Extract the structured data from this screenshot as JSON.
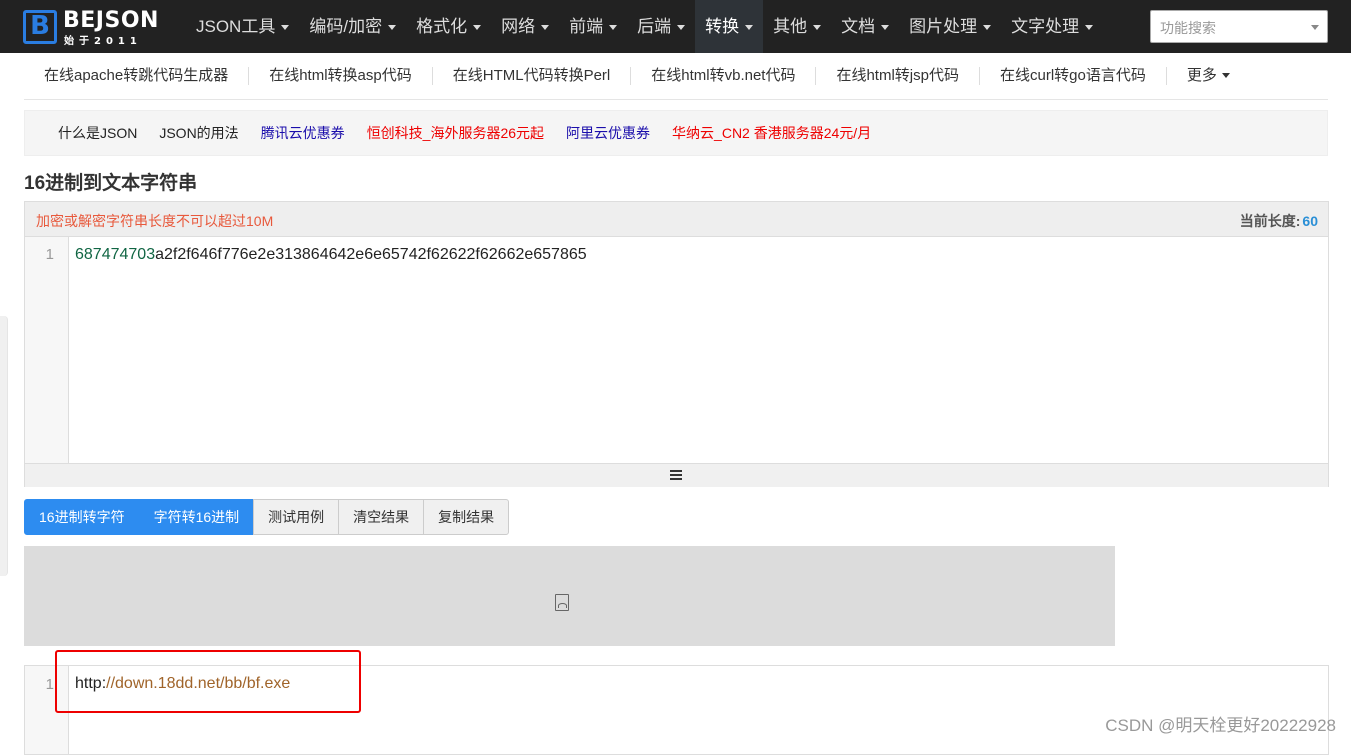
{
  "logo": {
    "brand": "BEJSON",
    "mark": "B",
    "tagline": "始于2011"
  },
  "nav": {
    "items": [
      {
        "label": "JSON工具",
        "active": false
      },
      {
        "label": "编码/加密",
        "active": false
      },
      {
        "label": "格式化",
        "active": false
      },
      {
        "label": "网络",
        "active": false
      },
      {
        "label": "前端",
        "active": false
      },
      {
        "label": "后端",
        "active": false
      },
      {
        "label": "转换",
        "active": true
      },
      {
        "label": "其他",
        "active": false
      },
      {
        "label": "文档",
        "active": false
      },
      {
        "label": "图片处理",
        "active": false
      },
      {
        "label": "文字处理",
        "active": false
      }
    ],
    "search_placeholder": "功能搜索"
  },
  "subtools": [
    "在线apache转跳代码生成器",
    "在线html转换asp代码",
    "在线HTML代码转换Perl",
    "在线html转vb.net代码",
    "在线html转jsp代码",
    "在线curl转go语言代码",
    "更多"
  ],
  "links": [
    {
      "label": "什么是JSON",
      "color": "dark"
    },
    {
      "label": "JSON的用法",
      "color": "dark"
    },
    {
      "label": "腾讯云优惠券",
      "color": "blue"
    },
    {
      "label": "恒创科技_海外服务器26元起",
      "color": "red"
    },
    {
      "label": "阿里云优惠券",
      "color": "blue"
    },
    {
      "label": "华纳云_CN2 香港服务器24元/月",
      "color": "red"
    }
  ],
  "page_title": "16进制到文本字符串",
  "editor": {
    "warning": "加密或解密字符串长度不可以超过10M",
    "length_label": "当前长度:",
    "length_value": "60",
    "line_number": "1",
    "code_number_part": "687474703",
    "code_rest": "a2f2f646f776e2e313864642e6e65742f62622f62662e657865"
  },
  "buttons": [
    {
      "label": "16进制转字符",
      "primary": true
    },
    {
      "label": "字符转16进制",
      "primary": true
    },
    {
      "label": "测试用例",
      "primary": false
    },
    {
      "label": "清空结果",
      "primary": false
    },
    {
      "label": "复制结果",
      "primary": false
    }
  ],
  "result": {
    "line_number": "1",
    "scheme": "http:",
    "url_rest": "//down.18dd.net/bb/bf.exe"
  },
  "watermark": "CSDN @明天栓更好20222928",
  "colors": {
    "nav_bg": "#222222",
    "primary": "#2d8cf0",
    "warning": "#e8593c",
    "highlight": "#ee0000"
  }
}
